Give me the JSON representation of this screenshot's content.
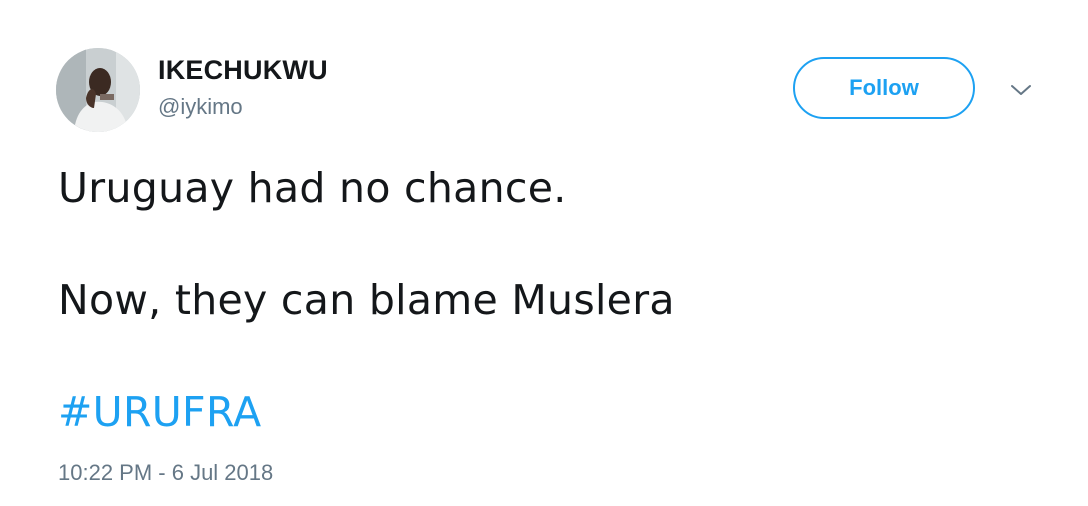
{
  "user": {
    "display_name": "IKECHUKWU",
    "handle": "@iykimo"
  },
  "actions": {
    "follow_label": "Follow",
    "more_icon": "chevron-down-icon"
  },
  "tweet": {
    "line1": "Uruguay had no chance.",
    "line2": "Now, they can blame Muslera",
    "hashtag": "#URUFRA",
    "timestamp": "10:22 PM - 6 Jul 2018"
  },
  "colors": {
    "accent": "#1da1f2",
    "text": "#14171a",
    "muted": "#657786"
  }
}
